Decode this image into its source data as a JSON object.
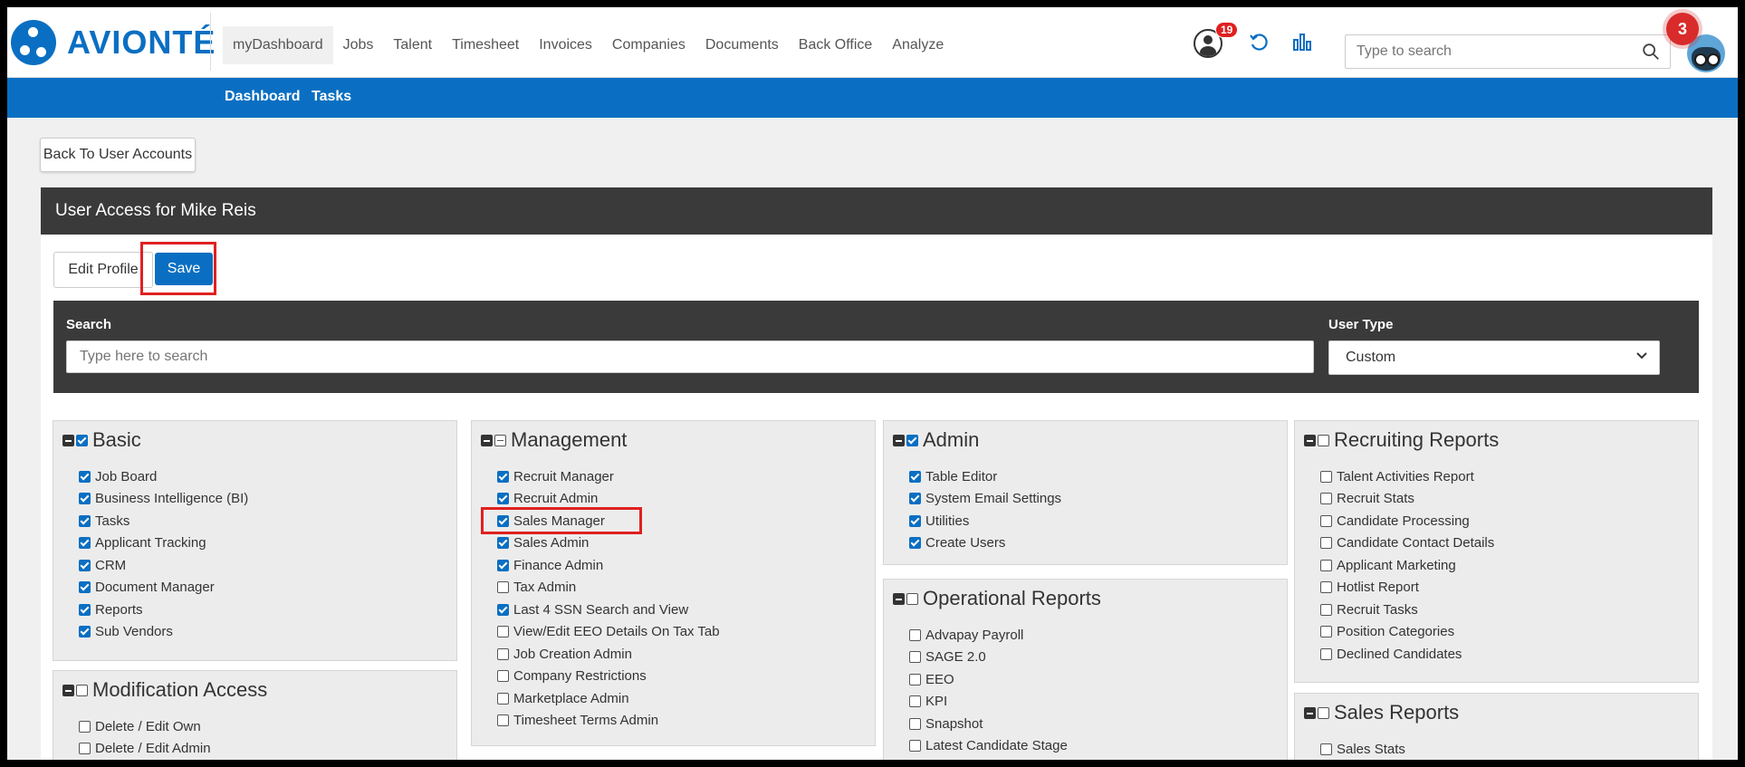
{
  "brand": {
    "name": "AVIONTÉ"
  },
  "nav": [
    "myDashboard",
    "Jobs",
    "Talent",
    "Timesheet",
    "Invoices",
    "Companies",
    "Documents",
    "Back Office",
    "Analyze"
  ],
  "top": {
    "notification_count": "19",
    "search_placeholder": "Type to search",
    "avatar_badge": "3"
  },
  "subnav": {
    "dashboard": "Dashboard",
    "tasks": "Tasks"
  },
  "back_button": "Back To User Accounts",
  "card": {
    "title": "User Access for Mike Reis",
    "edit_profile": "Edit Profile",
    "save": "Save"
  },
  "filter": {
    "search_label": "Search",
    "search_placeholder": "Type here to search",
    "user_type_label": "User Type",
    "user_type_value": "Custom"
  },
  "panels": {
    "basic": {
      "title": "Basic",
      "state": "checked",
      "items": [
        {
          "label": "Job Board",
          "checked": true
        },
        {
          "label": "Business Intelligence (BI)",
          "checked": true
        },
        {
          "label": "Tasks",
          "checked": true
        },
        {
          "label": "Applicant Tracking",
          "checked": true
        },
        {
          "label": "CRM",
          "checked": true
        },
        {
          "label": "Document Manager",
          "checked": true
        },
        {
          "label": "Reports",
          "checked": true
        },
        {
          "label": "Sub Vendors",
          "checked": true
        }
      ]
    },
    "modification": {
      "title": "Modification Access",
      "state": "unchecked",
      "items": [
        {
          "label": "Delete / Edit Own",
          "checked": false
        },
        {
          "label": "Delete / Edit Admin",
          "checked": false
        }
      ]
    },
    "management": {
      "title": "Management",
      "state": "partial",
      "items": [
        {
          "label": "Recruit Manager",
          "checked": true
        },
        {
          "label": "Recruit Admin",
          "checked": true
        },
        {
          "label": "Sales Manager",
          "checked": true
        },
        {
          "label": "Sales Admin",
          "checked": true
        },
        {
          "label": "Finance Admin",
          "checked": true
        },
        {
          "label": "Tax Admin",
          "checked": false
        },
        {
          "label": "Last 4 SSN Search and View",
          "checked": true
        },
        {
          "label": "View/Edit EEO Details On Tax Tab",
          "checked": false
        },
        {
          "label": "Job Creation Admin",
          "checked": false
        },
        {
          "label": "Company Restrictions",
          "checked": false
        },
        {
          "label": "Marketplace Admin",
          "checked": false
        },
        {
          "label": "Timesheet Terms Admin",
          "checked": false
        }
      ]
    },
    "admin": {
      "title": "Admin",
      "state": "checked",
      "items": [
        {
          "label": "Table Editor",
          "checked": true
        },
        {
          "label": "System Email Settings",
          "checked": true
        },
        {
          "label": "Utilities",
          "checked": true
        },
        {
          "label": "Create Users",
          "checked": true
        }
      ]
    },
    "operational": {
      "title": "Operational Reports",
      "state": "unchecked",
      "items": [
        {
          "label": "Advapay Payroll",
          "checked": false
        },
        {
          "label": "SAGE 2.0",
          "checked": false
        },
        {
          "label": "EEO",
          "checked": false
        },
        {
          "label": "KPI",
          "checked": false
        },
        {
          "label": "Snapshot",
          "checked": false
        },
        {
          "label": "Latest Candidate Stage",
          "checked": false
        }
      ]
    },
    "recruiting": {
      "title": "Recruiting Reports",
      "state": "unchecked",
      "items": [
        {
          "label": "Talent Activities Report",
          "checked": false
        },
        {
          "label": "Recruit Stats",
          "checked": false
        },
        {
          "label": "Candidate Processing",
          "checked": false
        },
        {
          "label": "Candidate Contact Details",
          "checked": false
        },
        {
          "label": "Applicant Marketing",
          "checked": false
        },
        {
          "label": "Hotlist Report",
          "checked": false
        },
        {
          "label": "Recruit Tasks",
          "checked": false
        },
        {
          "label": "Position Categories",
          "checked": false
        },
        {
          "label": "Declined Candidates",
          "checked": false
        }
      ]
    },
    "sales": {
      "title": "Sales Reports",
      "state": "unchecked",
      "items": [
        {
          "label": "Sales Stats",
          "checked": false
        }
      ]
    }
  }
}
